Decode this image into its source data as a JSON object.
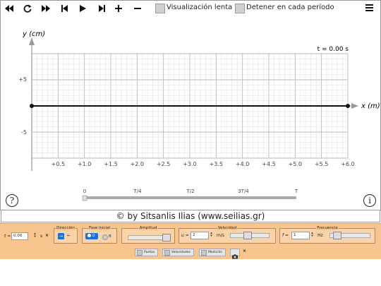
{
  "toolbar": {
    "checkbox_slow": "Visualización lenta",
    "checkbox_stop": "Detener en cada período"
  },
  "plot": {
    "y_axis_label": "y (cm)",
    "x_axis_label": "x (m)",
    "time_readout": "t = 0.00 s",
    "y_ticks": [
      "+5",
      "-5"
    ],
    "x_ticks": [
      "+0.5",
      "+1.0",
      "+1.5",
      "+2.0",
      "+2.5",
      "+3.0",
      "+3.5",
      "+4.0",
      "+4.5",
      "+5.0",
      "+5.5",
      "+6.0"
    ],
    "time_ticks": [
      "0",
      "T/4",
      "T/2",
      "3T/4",
      "T"
    ]
  },
  "buttons": {
    "help": "?",
    "info": "i"
  },
  "credit": "© by Sitsanlis Ilias (www.seilias.gr)",
  "controls": {
    "t_label": "t =",
    "t_value": "0.00",
    "t_unit": "s",
    "direction_title": "Dirección",
    "phase_title": "Fase inicial",
    "phase_0": "0",
    "phase_pi": "π",
    "amplitude_title": "Amplitud",
    "velocity_title": "Velocidad",
    "u_label": "u =",
    "u_value": "2",
    "u_unit": "m/s",
    "frequency_title": "Frecuencia",
    "f_label": "f =",
    "f_value": "1",
    "f_unit": "Hz",
    "btn_points": "Puntos",
    "btn_velocities": "Velocidades",
    "btn_measure": "Medición"
  }
}
